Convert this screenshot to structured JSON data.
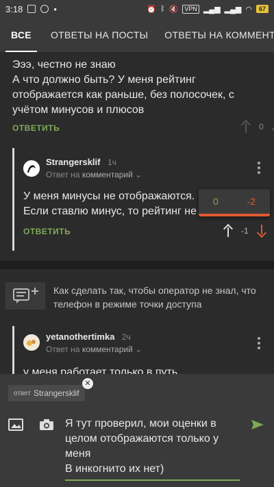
{
  "status_bar": {
    "time": "3:18",
    "vpn": "VPN",
    "battery": "67"
  },
  "tabs": [
    {
      "label": "ВСЕ",
      "active": true
    },
    {
      "label": "ОТВЕТЫ НА ПОСТЫ",
      "active": false
    },
    {
      "label": "ОТВЕТЫ НА КОММЕНТАРИИ",
      "active": false
    }
  ],
  "comment1": {
    "text_line1": "Эээ, честно не знаю",
    "text_rest": "А что должно быть? У меня рейтинг отображается как раньше, без полосочек, с учётом минусов и плюсов",
    "reply_label": "ОТВЕТИТЬ",
    "score": "0"
  },
  "comment2": {
    "username": "Strangersklif",
    "time": "1ч",
    "reply_to_prefix": "Ответ на",
    "reply_to_target": "комментарий",
    "text": "У меня минусы не отображаются. Если ставлю минус, то рейтинг не меняется",
    "reply_label": "ОТВЕТИТЬ",
    "score": "-1",
    "popup_plus": "0",
    "popup_minus": "-2"
  },
  "post_link": {
    "title": "Как сделать так, чтобы оператор не знал, что телефон в режиме точки доступа"
  },
  "comment3": {
    "username": "yetanothertimka",
    "time": "2ч",
    "reply_to_prefix": "Ответ на",
    "reply_to_target": "комментарий",
    "text_partial": "у меня работает только в путь"
  },
  "reply_panel": {
    "chip_prefix": "ответ",
    "chip_user": "Strangersklif",
    "draft": "Я тут проверил, мои оценки в целом отображаются только у меня\nВ инкогнито их нет)"
  },
  "colors": {
    "accent_green": "#7fab57",
    "minus_red": "#e05a33",
    "background": "#2b2b2b"
  }
}
